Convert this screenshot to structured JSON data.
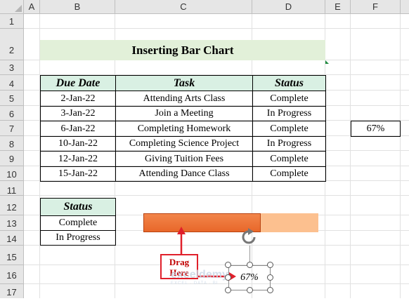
{
  "columns": [
    "A",
    "B",
    "C",
    "D",
    "E",
    "F"
  ],
  "rows": [
    "1",
    "2",
    "3",
    "4",
    "5",
    "6",
    "7",
    "8",
    "9",
    "10",
    "11",
    "12",
    "13",
    "14",
    "15",
    "16",
    "17"
  ],
  "title": "Inserting Bar Chart",
  "table": {
    "headers": [
      "Due Date",
      "Task",
      "Status"
    ],
    "rows": [
      [
        "2-Jan-22",
        "Attending Arts Class",
        "Complete"
      ],
      [
        "3-Jan-22",
        "Join a Meeting",
        "In Progress"
      ],
      [
        "6-Jan-22",
        "Completing Homework",
        "Complete"
      ],
      [
        "10-Jan-22",
        "Completing Science Project",
        "In Progress"
      ],
      [
        "12-Jan-22",
        "Giving Tuition Fees",
        "Complete"
      ],
      [
        "15-Jan-22",
        "Attending Dance Class",
        "Complete"
      ]
    ]
  },
  "percent_cell": "67%",
  "status_list": {
    "header": "Status",
    "items": [
      "Complete",
      "In Progress"
    ]
  },
  "progress": {
    "fraction": 0.67,
    "label": "67%",
    "fill_color": "#e8672a",
    "track_color": "#fcc08f"
  },
  "callout": {
    "line1": "Drag",
    "line2": "Here"
  },
  "watermark": {
    "brand": "exceldemy",
    "tagline": "EXCEL · DATA · BI"
  },
  "icons": {
    "rotate": "rotate-handle-icon",
    "arrow": "drag-arrow-icon"
  }
}
